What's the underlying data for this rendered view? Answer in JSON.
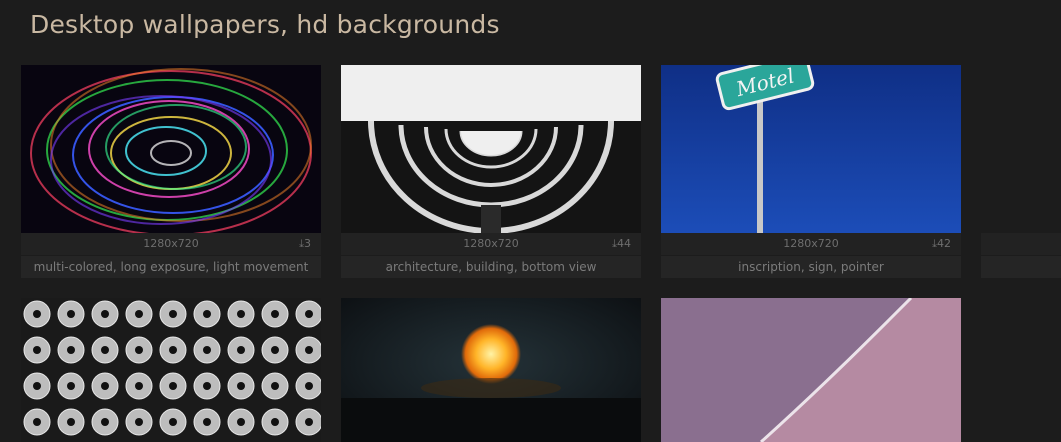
{
  "page": {
    "title": "Desktop wallpapers, hd backgrounds"
  },
  "row1": [
    {
      "resolution": "1280x720",
      "downloads": "3",
      "tags": "multi-colored, long exposure, light movement"
    },
    {
      "resolution": "1280x720",
      "downloads": "44",
      "tags": "architecture, building, bottom view"
    },
    {
      "resolution": "1280x720",
      "downloads": "42",
      "tags": "inscription, sign, pointer",
      "sign_text": "Motel"
    },
    {
      "resolution": "",
      "downloads": "",
      "tags": ""
    }
  ],
  "icons": {
    "download": "download-icon"
  },
  "colors": {
    "background": "#1c1c1c",
    "title": "#c9b8a2",
    "meta": "#6e6e6e"
  }
}
